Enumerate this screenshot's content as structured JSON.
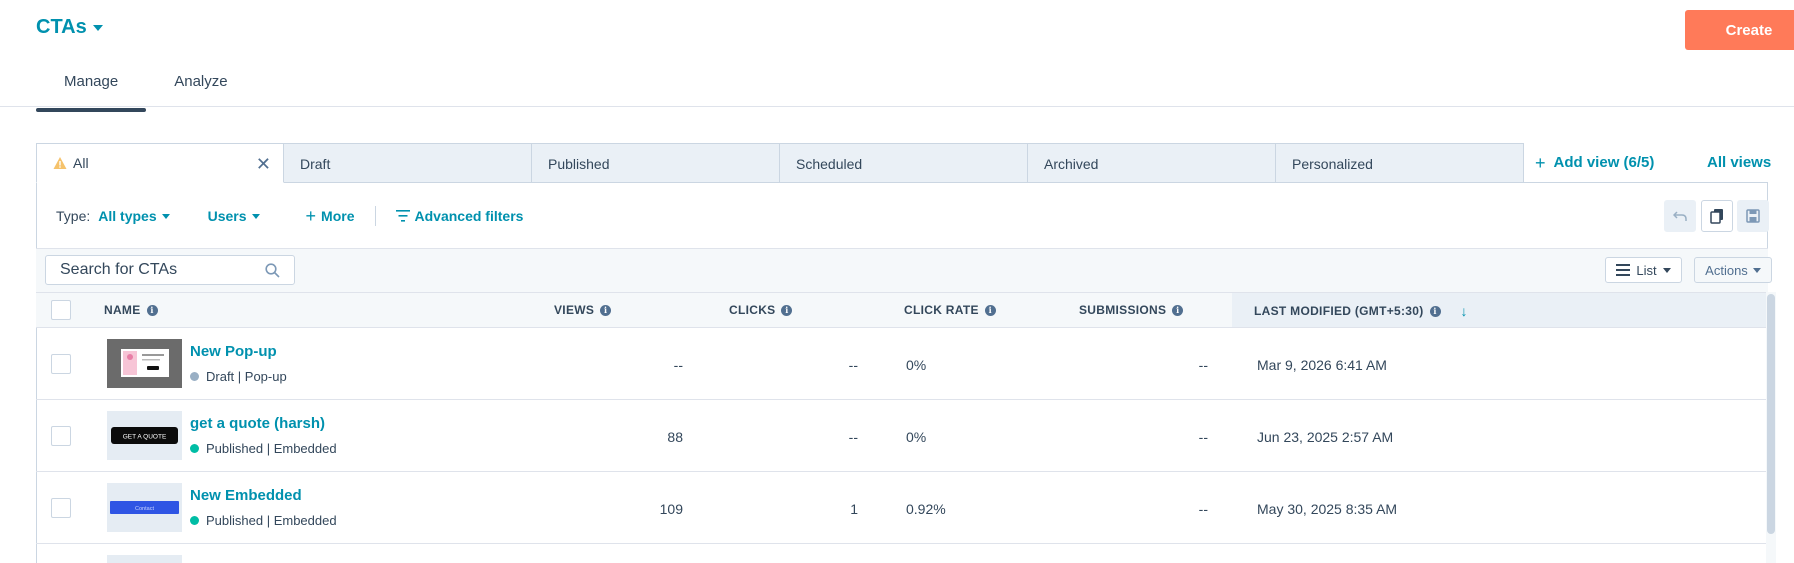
{
  "header": {
    "title": "CTAs",
    "create_label": "Create",
    "tabs": [
      {
        "label": "Manage",
        "active": true
      },
      {
        "label": "Analyze",
        "active": false
      }
    ]
  },
  "view_tabs": [
    {
      "label": "All",
      "active": true,
      "warning": true,
      "closable": true
    },
    {
      "label": "Draft"
    },
    {
      "label": "Published"
    },
    {
      "label": "Scheduled"
    },
    {
      "label": "Archived"
    },
    {
      "label": "Personalized"
    }
  ],
  "add_view_label": "Add view (6/5)",
  "all_views_label": "All views",
  "filters": {
    "type_label": "Type:",
    "type_value": "All types",
    "users_label": "Users",
    "more_label": "More",
    "advanced_label": "Advanced filters"
  },
  "search": {
    "placeholder": "Search for CTAs"
  },
  "list_label": "List",
  "actions_label": "Actions",
  "columns": {
    "name": "NAME",
    "views": "VIEWS",
    "clicks": "CLICKS",
    "click_rate": "CLICK RATE",
    "submissions": "SUBMISSIONS",
    "last_modified": "LAST MODIFIED (GMT+5:30)"
  },
  "rows": [
    {
      "name": "New Pop-up",
      "status": "Draft | Pop-up",
      "status_color": "#99afc4",
      "views": "--",
      "clicks": "--",
      "click_rate": "0%",
      "submissions": "--",
      "last_modified": "Mar 9, 2026 6:41 AM",
      "thumb": "popup"
    },
    {
      "name": "get a quote (harsh)",
      "status": "Published | Embedded",
      "status_color": "#00bda5",
      "views": "88",
      "clicks": "--",
      "click_rate": "0%",
      "submissions": "--",
      "last_modified": "Jun 23, 2025 2:57 AM",
      "thumb": "quote",
      "thumb_text": "GET A QUOTE"
    },
    {
      "name": "New Embedded",
      "status": "Published | Embedded",
      "status_color": "#00bda5",
      "views": "109",
      "clicks": "1",
      "click_rate": "0.92%",
      "submissions": "--",
      "last_modified": "May 30, 2025 8:35 AM",
      "thumb": "embedded",
      "thumb_text": "Contact"
    }
  ],
  "colors": {
    "accent": "#0091ae",
    "create": "#ff7a59",
    "text": "#33475b"
  }
}
